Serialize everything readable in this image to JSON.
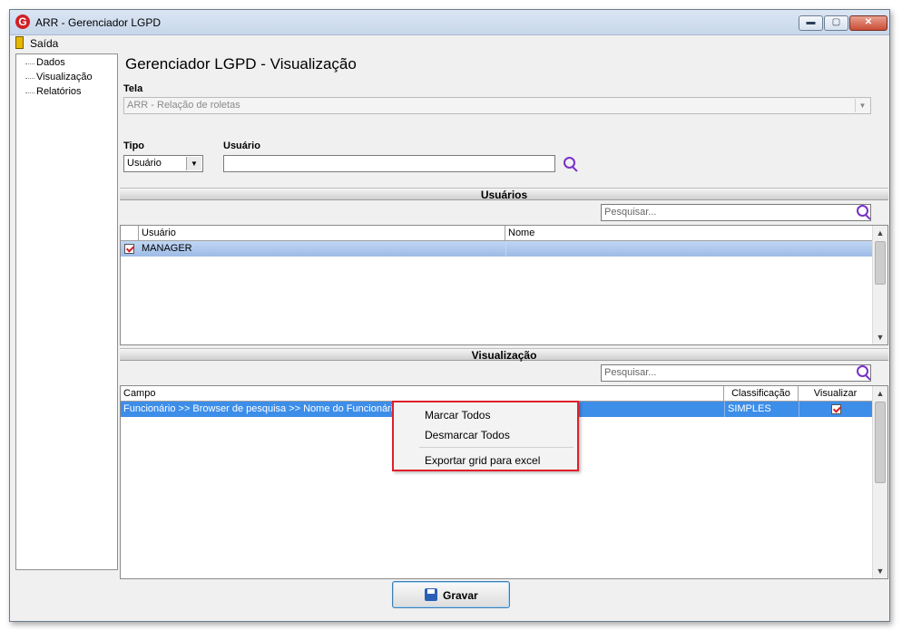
{
  "window": {
    "title": "ARR - Gerenciador LGPD",
    "icon": "G"
  },
  "menu": {
    "exit_label": "Saída"
  },
  "tree": {
    "items": [
      "Dados",
      "Visualização",
      "Relatórios"
    ]
  },
  "page_title": "Gerenciador LGPD - Visualização",
  "tela": {
    "label": "Tela",
    "value": "ARR -  Relação de roletas"
  },
  "tipo": {
    "label": "Tipo",
    "value": "Usuário"
  },
  "usuario": {
    "label": "Usuário",
    "value": ""
  },
  "usuarios_section": {
    "title": "Usuários",
    "search_placeholder": "Pesquisar...",
    "columns": [
      "Usuário",
      "Nome"
    ],
    "rows": [
      {
        "checked": true,
        "usuario": "MANAGER",
        "nome": ""
      }
    ]
  },
  "visualizacao_section": {
    "title": "Visualização",
    "search_placeholder": "Pesquisar...",
    "columns": [
      "Campo",
      "Classificação",
      "Visualizar"
    ],
    "rows": [
      {
        "campo": "Funcionário >> Browser de pesquisa >> Nome do Funcionário",
        "classificacao": "SIMPLES",
        "visualizar": true
      }
    ]
  },
  "context_menu": {
    "items": [
      "Marcar Todos",
      "Desmarcar Todos",
      "Exportar grid para excel"
    ]
  },
  "buttons": {
    "gravar": "Gravar"
  },
  "colors": {
    "accent_red": "#d11f25",
    "selection_blue": "#3d8ee9",
    "highlight_border": "#e0202a"
  }
}
